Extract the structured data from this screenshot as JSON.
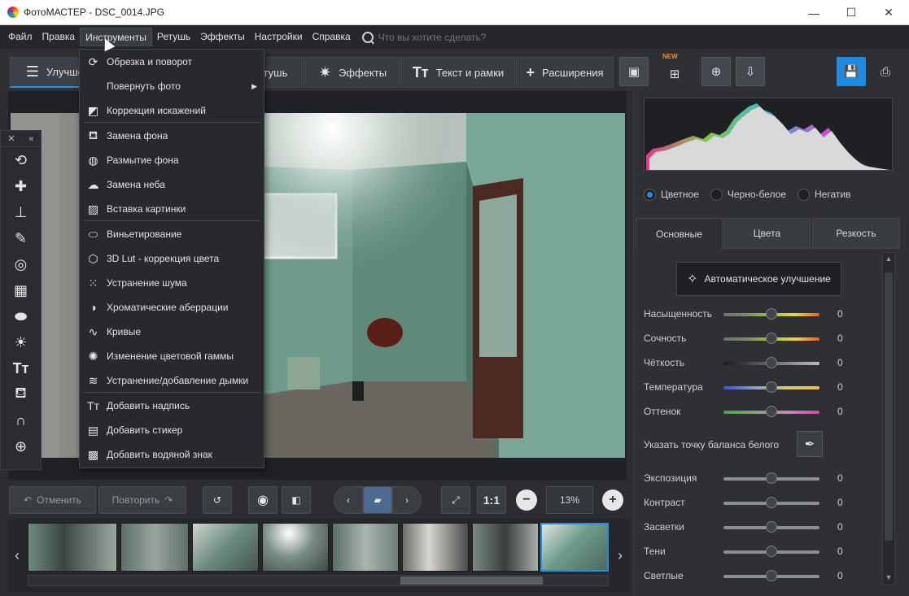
{
  "window": {
    "title": "ФотоМАСТЕР - DSC_0014.JPG",
    "minimize": "—",
    "maximize": "☐",
    "close": "✕"
  },
  "menu": {
    "items": [
      "Файл",
      "Правка",
      "Инструменты",
      "Ретушь",
      "Эффекты",
      "Настройки",
      "Справка"
    ],
    "search_placeholder": "Что вы хотите сделать?"
  },
  "toolbar": {
    "tabs": [
      {
        "label": "Улучшен",
        "icon": "sliders-icon"
      },
      {
        "label": "Ретушь",
        "icon": "retouch-icon"
      },
      {
        "label": "Эффекты",
        "icon": "effects-icon"
      },
      {
        "label": "Текст и рамки",
        "icon": "text-icon"
      },
      {
        "label": "Расширения",
        "icon": "plus-icon"
      }
    ],
    "new_badge": "NEW"
  },
  "dropdown": {
    "items": [
      {
        "label": "Обрезка и поворот",
        "icon": "crop-rotate-icon"
      },
      {
        "label": "Повернуть фото",
        "icon": "none",
        "submenu": true
      },
      {
        "label": "Коррекция искажений",
        "icon": "distortion-icon"
      },
      {
        "label": "Замена фона",
        "icon": "bucket-icon"
      },
      {
        "label": "Размытие фона",
        "icon": "blur-icon"
      },
      {
        "label": "Замена неба",
        "icon": "cloud-icon"
      },
      {
        "label": "Вставка картинки",
        "icon": "insert-image-icon"
      },
      {
        "label": "Виньетирование",
        "icon": "vignette-icon"
      },
      {
        "label": "3D Lut - коррекция цвета",
        "icon": "cube-icon"
      },
      {
        "label": "Устранение шума",
        "icon": "noise-icon"
      },
      {
        "label": "Хроматические аберрации",
        "icon": "aberration-icon"
      },
      {
        "label": "Кривые",
        "icon": "curves-icon"
      },
      {
        "label": "Изменение цветовой гаммы",
        "icon": "aperture-icon"
      },
      {
        "label": "Устранение/добавление дымки",
        "icon": "haze-icon"
      },
      {
        "label": "Добавить надпись",
        "icon": "text-icon"
      },
      {
        "label": "Добавить стикер",
        "icon": "sticker-icon"
      },
      {
        "label": "Добавить водяной знак",
        "icon": "watermark-icon"
      }
    ]
  },
  "controls": {
    "undo": "Отменить",
    "redo": "Повторить",
    "ratio": "1:1",
    "zoom": "13%"
  },
  "right_panel": {
    "modes": [
      {
        "label": "Цветное",
        "selected": true
      },
      {
        "label": "Черно-белое",
        "selected": false
      },
      {
        "label": "Негатив",
        "selected": false
      }
    ],
    "tabs": [
      "Основные",
      "Цвета",
      "Резкость"
    ],
    "auto_button": "Автоматическое улучшение",
    "white_balance_label": "Указать точку баланса белого",
    "sliders_top": [
      {
        "label": "Насыщенность",
        "value": "0",
        "gradient": "linear-gradient(90deg,#6b6f74,#7d8b6f,#a5c33a,#f0d53a,#e85a2a)"
      },
      {
        "label": "Сочность",
        "value": "0",
        "gradient": "linear-gradient(90deg,#6b6f74,#7d8b6f,#a5c33a,#f0d53a,#e85a2a)"
      },
      {
        "label": "Чёткость",
        "value": "0",
        "gradient": "linear-gradient(90deg,#1a1a1a,#6a6a6a,#bdbdbd)"
      },
      {
        "label": "Температура",
        "value": "0",
        "gradient": "linear-gradient(90deg,#3a52d8,#8aa0c0,#d8c87a,#f0c030)"
      },
      {
        "label": "Оттенок",
        "value": "0",
        "gradient": "linear-gradient(90deg,#3da83a,#8aa07a,#c08ab0,#d840c0)"
      }
    ],
    "sliders_bottom": [
      {
        "label": "Экспозиция",
        "value": "0"
      },
      {
        "label": "Контраст",
        "value": "0"
      },
      {
        "label": "Засветки",
        "value": "0"
      },
      {
        "label": "Тени",
        "value": "0"
      },
      {
        "label": "Светлые",
        "value": "0"
      }
    ]
  }
}
